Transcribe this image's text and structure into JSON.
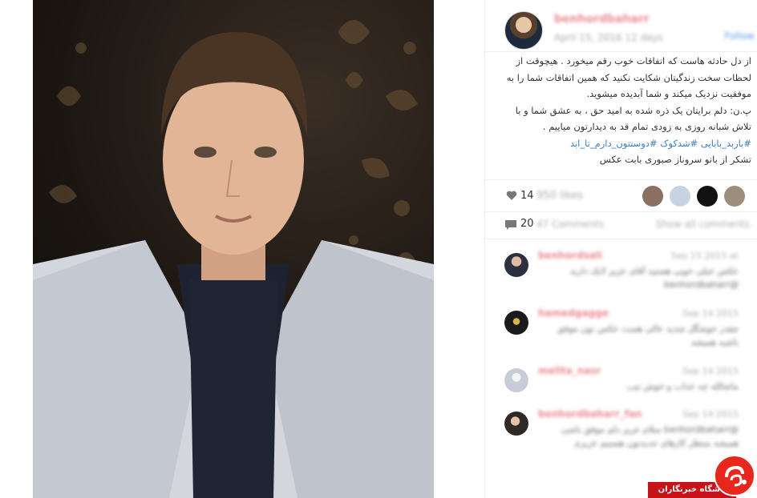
{
  "post": {
    "username": "benhordbaharr",
    "date": "April 15, 2016 12 days",
    "follow_label": "Follow"
  },
  "caption": {
    "line1": "از دل حادثه هاست که اتفاقات خوب رقم میخورد . هیچوقت از لحظات سخت زندگیتان شکایت نکنید که همین اتفاقات شما را به موفقیت نزدیک میکند و شما آبدیده میشوید.",
    "line2": "پ.ن: دلم برایتان یک ذره شده به امید حق ، به عشق شما و با تلاش شبانه روزی به زودی تمام قد به دیدارتون میاییم .",
    "tags": "#باربد_بابایی #شدکوک #دوستتون_دارم_تا_ابد",
    "line3": "تشکر از بانو سروناز صبوری بابت عکس"
  },
  "likes": {
    "count": "14",
    "blurred": "950 likes"
  },
  "comments": {
    "count": "20",
    "blurred": "47 Comments",
    "show_all": "Show all comments",
    "items": [
      {
        "user": "benhordsali",
        "time": "Sep 15 2015 at",
        "text": "عکس خیلی خوبی هستید آقای عزیز لایک دارید @benhordbaharr"
      },
      {
        "user": "hamedgagge",
        "time": "Sep 14 2015",
        "text": "چقدر خوشگل شدید عالی هست عکس تون موفق باشید همیشه"
      },
      {
        "user": "melita_nasr",
        "time": "Sep 14 2015",
        "text": "ماشالله چه جذاب و خوش تیپ"
      },
      {
        "user": "benhordbaharr_fan",
        "time": "Sep 14 2015",
        "text": "@benhordbaharr سلام عزیز دلم موفق باشی همیشه منتظر کارهای جدیدتون هستیم عزیزم"
      }
    ]
  },
  "watermark": {
    "label": "باشگاه خبرنگاران"
  }
}
